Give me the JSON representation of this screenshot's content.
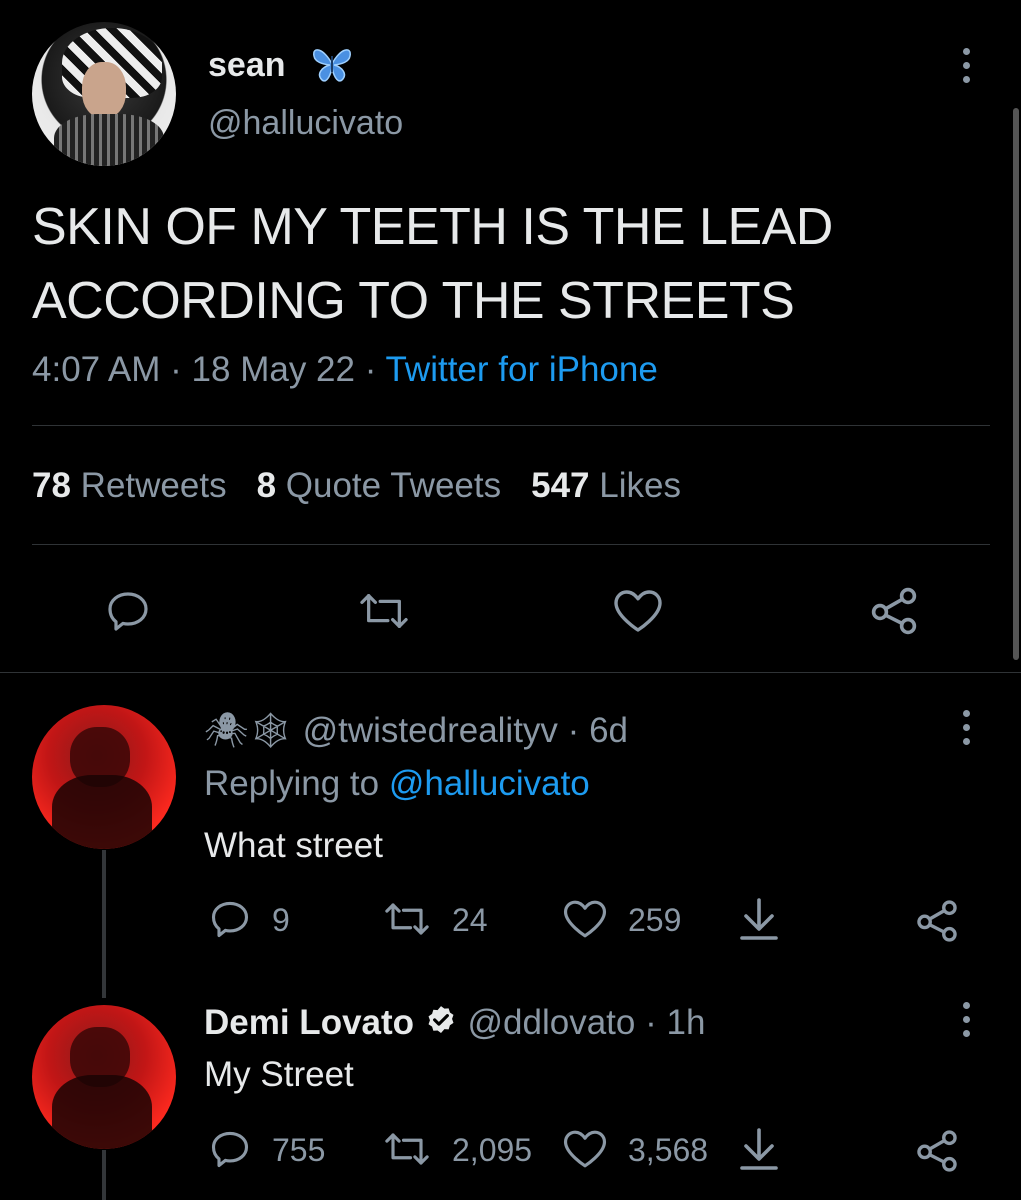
{
  "tweet": {
    "display_name": "sean",
    "handle": "@hallucivato",
    "text": "SKIN OF MY TEETH IS THE LEAD ACCORDING TO THE STREETS",
    "time": "4:07 AM",
    "separator": "·",
    "date": "18 May 22",
    "source": "Twitter for iPhone",
    "stats": {
      "retweets_count": "78",
      "retweets_label": "Retweets",
      "quotes_count": "8",
      "quotes_label": "Quote Tweets",
      "likes_count": "547",
      "likes_label": "Likes"
    }
  },
  "replies": [
    {
      "emoji_name": "🕷🕸",
      "handle": "@twistedrealityv",
      "separator": "·",
      "age": "6d",
      "replying_prefix": "Replying to",
      "replying_to": "@hallucivato",
      "text": "What street",
      "replies_count": "9",
      "retweets_count": "24",
      "likes_count": "259"
    },
    {
      "display_name": "Demi Lovato",
      "handle": "@ddlovato",
      "separator": "·",
      "age": "1h",
      "text": "My Street",
      "replies_count": "755",
      "retweets_count": "2,095",
      "likes_count": "3,568"
    }
  ],
  "colors": {
    "background": "#000000",
    "text": "#e7e9ea",
    "secondary": "#8b98a5",
    "accent": "#1d9bf0",
    "divider": "#2f3336"
  },
  "icons": {
    "verified": "verified-badge-icon",
    "reply": "reply-icon",
    "retweet": "retweet-icon",
    "like": "like-icon",
    "share": "share-icon",
    "more": "more-icon",
    "download": "download-icon",
    "butterfly": "butterfly-icon"
  }
}
